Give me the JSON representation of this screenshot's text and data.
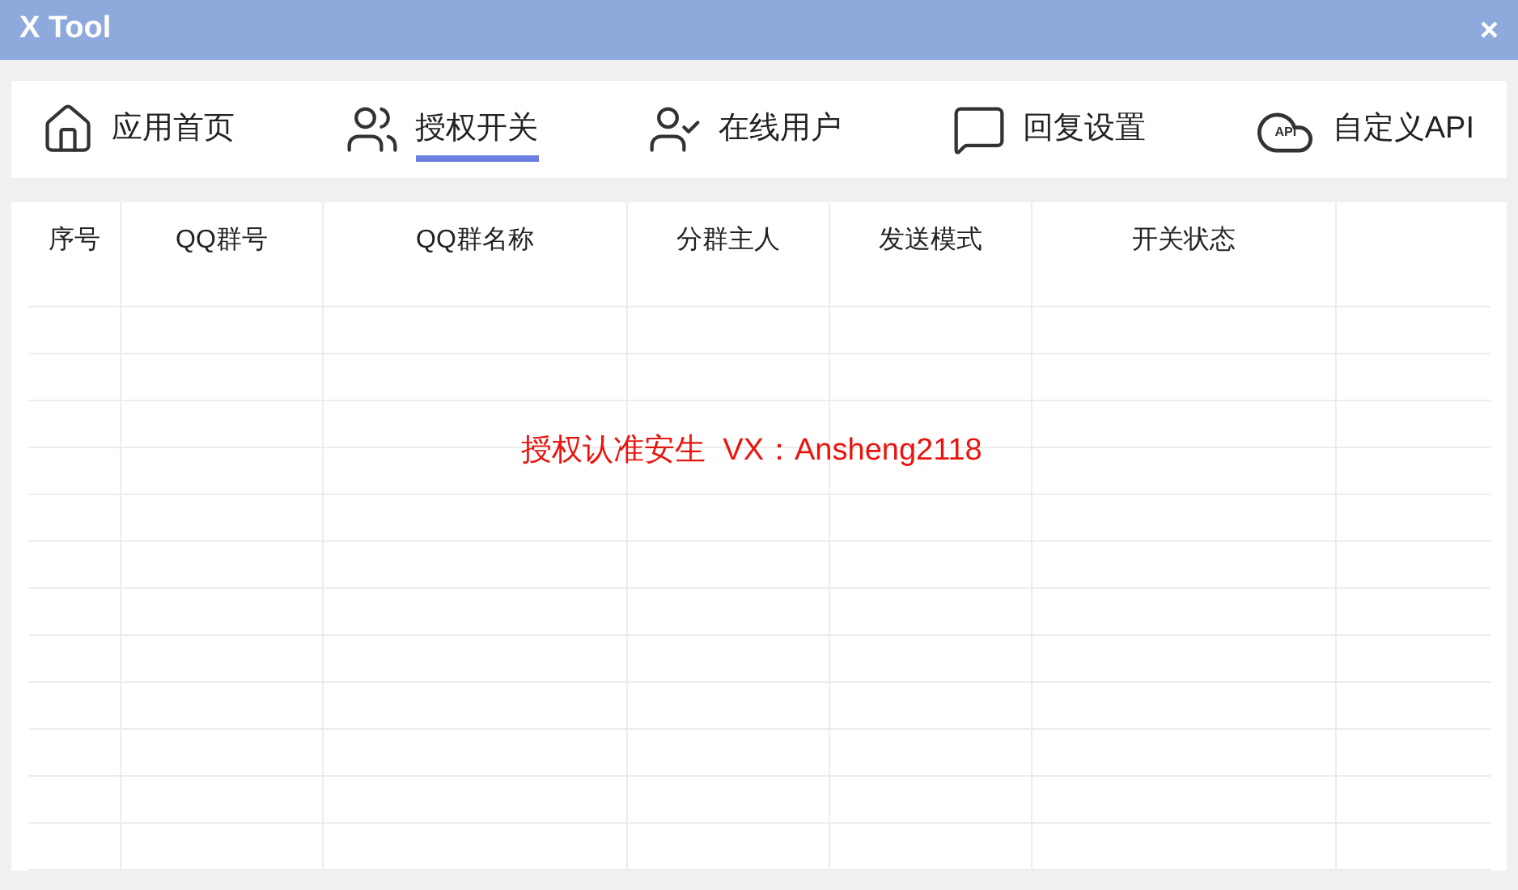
{
  "window": {
    "title": "X Tool",
    "close": "×"
  },
  "tabs": [
    {
      "label": "应用首页",
      "kind": "home",
      "selected": false
    },
    {
      "label": "授权开关",
      "kind": "users",
      "selected": true
    },
    {
      "label": "在线用户",
      "kind": "user-check",
      "selected": false
    },
    {
      "label": "回复设置",
      "kind": "message",
      "selected": false
    },
    {
      "label": "自定义API",
      "kind": "cloud",
      "icon_text": "API",
      "selected": false
    }
  ],
  "table": {
    "columns": [
      "序号",
      "QQ群号",
      "QQ群名称",
      "分群主人",
      "发送模式",
      "开关状态"
    ]
  },
  "notice": "授权认准安生  VX：Ansheng2118"
}
